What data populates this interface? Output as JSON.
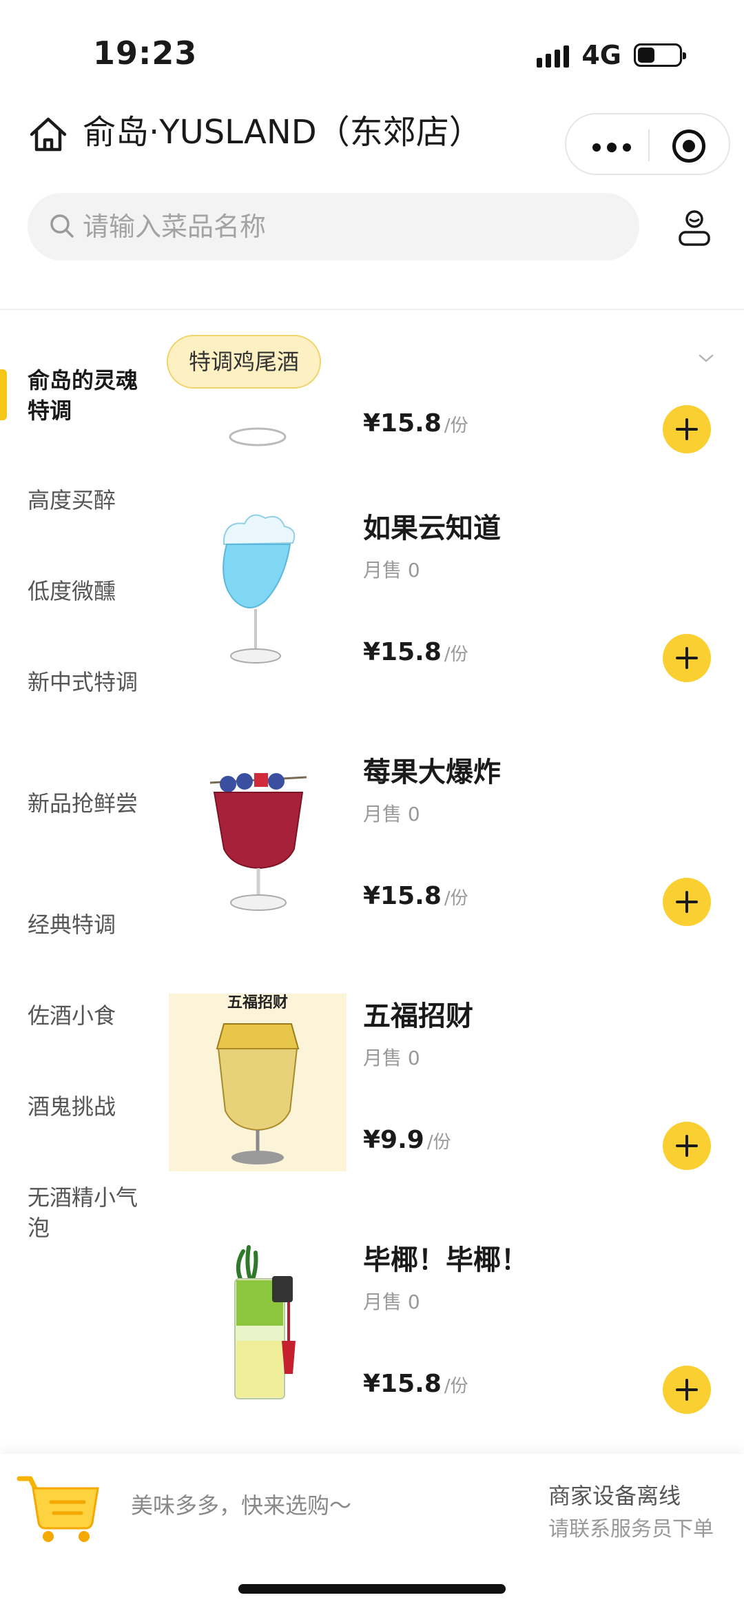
{
  "status_bar": {
    "time": "19:23",
    "network": "4G"
  },
  "header": {
    "store_title": "俞岛·YUSLAND（东郊店）"
  },
  "search": {
    "placeholder": "请输入菜品名称"
  },
  "sidebar": {
    "items": [
      {
        "label": "俞岛的灵魂特调",
        "active": true
      },
      {
        "label": "高度买醉"
      },
      {
        "label": "低度微醺"
      },
      {
        "label": "新中式特调"
      },
      {
        "label": "新品抢鲜尝"
      },
      {
        "label": "经典特调"
      },
      {
        "label": "佐酒小食"
      },
      {
        "label": "酒鬼挑战"
      },
      {
        "label": "无酒精小气泡"
      }
    ]
  },
  "category": {
    "current": "特调鸡尾酒"
  },
  "products": [
    {
      "name": "",
      "sales": "",
      "price": "¥15.8",
      "unit": "/份",
      "image": "cocktail-glass"
    },
    {
      "name": "如果云知道",
      "sales": "月售 0",
      "price": "¥15.8",
      "unit": "/份",
      "image": "blue-cloud-cocktail"
    },
    {
      "name": "莓果大爆炸",
      "sales": "月售 0",
      "price": "¥15.8",
      "unit": "/份",
      "image": "berry-cocktail"
    },
    {
      "name": "五福招财",
      "sales": "月售 0",
      "price": "¥9.9",
      "unit": "/份",
      "image": "wufu-cocktail",
      "image_text": "五福招财"
    },
    {
      "name": "毕椰！毕椰！",
      "sales": "月售 0",
      "price": "¥15.8",
      "unit": "/份",
      "image": "green-coconut-cocktail"
    }
  ],
  "bottom_bar": {
    "cart_hint": "美味多多，快来选购～",
    "offline_title": "商家设备离线",
    "offline_sub": "请联系服务员下单"
  },
  "colors": {
    "accent": "#f9cf32",
    "indicator": "#f5c518",
    "chip_bg": "#fdf1c4"
  }
}
